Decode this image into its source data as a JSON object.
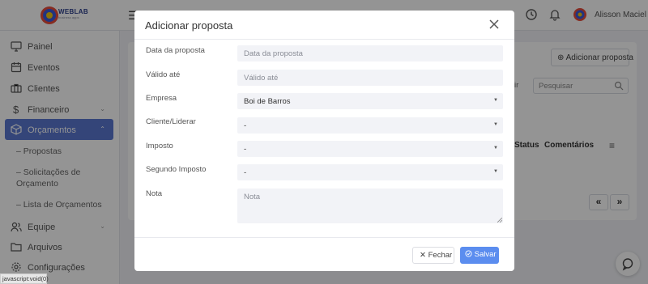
{
  "app": {
    "logo_text": "WEBLAB",
    "logo_subtext": "business apps",
    "user_name": "Alisson Maciel"
  },
  "sidebar": {
    "items": [
      {
        "label": "Painel",
        "icon": "monitor-icon"
      },
      {
        "label": "Eventos",
        "icon": "calendar-icon"
      },
      {
        "label": "Clientes",
        "icon": "briefcase-icon"
      },
      {
        "label": "Financeiro",
        "icon": "dollar-icon"
      },
      {
        "label": "Orçamentos",
        "icon": "box-icon"
      },
      {
        "label": "Equipe",
        "icon": "users-icon"
      },
      {
        "label": "Arquivos",
        "icon": "folder-icon"
      },
      {
        "label": "Configurações",
        "icon": "gear-icon"
      }
    ],
    "subitems": [
      {
        "label": "– Propostas"
      },
      {
        "label": "– Solicitações de Orçamento"
      },
      {
        "label": "– Lista de Orçamentos"
      }
    ],
    "accent_color": "#5a78d1"
  },
  "background_page": {
    "add_button_label": "Adicionar proposta",
    "search_placeholder": "Pesquisar",
    "filter_label_partial": "ir",
    "columns_visible": [
      "Status",
      "Comentários"
    ],
    "pager": [
      "«",
      "»"
    ]
  },
  "status_bar_text": "javascript:void(0)",
  "modal": {
    "title": "Adicionar proposta",
    "fields": {
      "data_proposta": {
        "label": "Data da proposta",
        "placeholder": "Data da proposta",
        "value": ""
      },
      "valido_ate": {
        "label": "Válido até",
        "placeholder": "Válido até",
        "value": ""
      },
      "empresa": {
        "label": "Empresa",
        "value": "Boi de Barros"
      },
      "cliente": {
        "label": "Cliente/Liderar",
        "value": "-"
      },
      "imposto": {
        "label": "Imposto",
        "value": "-"
      },
      "segundo_imposto": {
        "label": "Segundo Imposto",
        "value": "-"
      },
      "nota": {
        "label": "Nota",
        "placeholder": "Nota",
        "value": ""
      }
    },
    "buttons": {
      "close_label": "Fechar",
      "save_label": "Salvar"
    },
    "save_color": "#5b8def"
  }
}
